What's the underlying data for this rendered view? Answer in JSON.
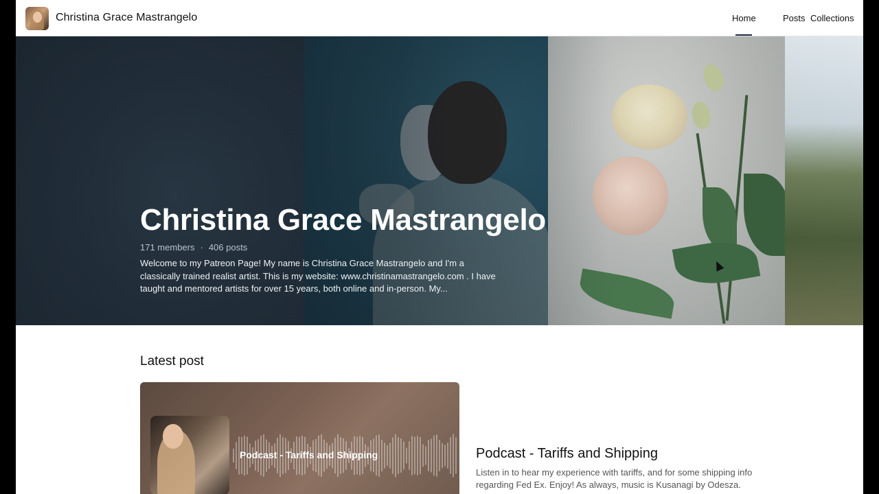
{
  "header": {
    "creator_name": "Christina Grace Mastrangelo",
    "nav": [
      {
        "label": "Home"
      },
      {
        "label": "Posts"
      },
      {
        "label": "Collections"
      }
    ],
    "active_tab": "Home"
  },
  "hero": {
    "title": "Christina Grace Mastrangelo",
    "members": "171 members",
    "separator": "·",
    "posts": "406 posts",
    "description": "Welcome to my Patreon Page! My name is Christina Grace Mastrangelo and I'm a classically trained realist artist. This is my website: www.christinamastrangelo.com . I have taught and mentored artists for over 15 years, both online and in-person. My..."
  },
  "latest": {
    "section_title": "Latest post",
    "card_overlay_title": "Podcast - Tariffs and Shipping",
    "post_title": "Podcast - Tariffs and Shipping",
    "post_description": "Listen in to hear my experience with tariffs, and for some shipping info regarding Fed Ex. Enjoy! As always, music is Kusanagi by Odesza."
  },
  "icons": {
    "avatar": "creator-avatar",
    "cursor": "mouse-pointer-icon"
  }
}
